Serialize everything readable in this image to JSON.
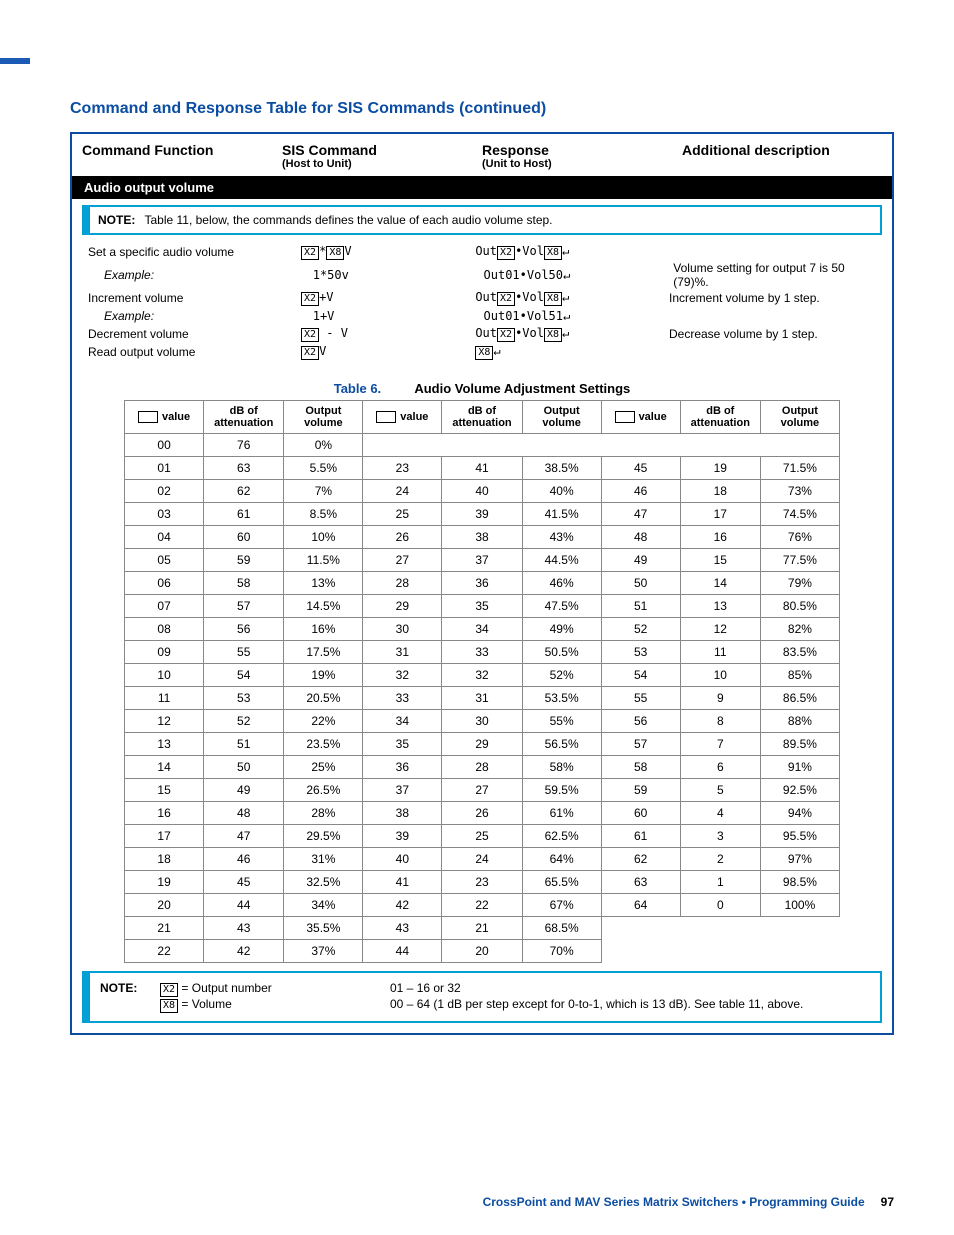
{
  "section_title": "Command and Response Table for SIS Commands (continued)",
  "headers": {
    "h1": "Command Function",
    "h2": "SIS Command",
    "h2s": "(Host to Unit)",
    "h3": "Response",
    "h3s": "(Unit to Host)",
    "h4": "Additional description"
  },
  "blackbar": "Audio output volume",
  "note": "NOTE:",
  "note_text": "Table 11, below, the commands defines the value of each audio volume step.",
  "commands": [
    {
      "name": "Set a specific audio volume",
      "cmd": "[X2]*[X8]V",
      "resp": "Out[X2]•Vol[X8]↵",
      "desc": ""
    },
    {
      "name": "Example:",
      "example": true,
      "cmd": "1*50v",
      "resp": "Out01•Vol50↵",
      "desc": "Volume setting for output 7 is 50 (79)%."
    },
    {
      "name": "Increment volume",
      "cmd": "[X2]+V",
      "resp": "Out[X2]•Vol[X8]↵",
      "desc": "Increment volume by 1 step."
    },
    {
      "name": "Example:",
      "example": true,
      "cmd": "1+V",
      "resp": "Out01•Vol51↵",
      "desc": ""
    },
    {
      "name": "Decrement volume",
      "cmd": "[X2] - V",
      "resp": "Out[X2]•Vol[X8]↵",
      "desc": "Decrease volume by 1 step."
    },
    {
      "name": "Read output volume",
      "cmd": "[X2]V",
      "resp": "[X8]↵",
      "desc": ""
    }
  ],
  "table_caption": {
    "num": "Table 6.",
    "title": "Audio Volume Adjustment Settings"
  },
  "col_labels": {
    "value": "value",
    "db": "dB of\nattenuation",
    "out": "Output\nvolume"
  },
  "chart_data": {
    "type": "table",
    "columns": [
      "value",
      "dB_attenuation",
      "output_volume"
    ],
    "rows": [
      [
        "00",
        76,
        "0%"
      ],
      [
        "01",
        63,
        "5.5%"
      ],
      [
        "02",
        62,
        "7%"
      ],
      [
        "03",
        61,
        "8.5%"
      ],
      [
        "04",
        60,
        "10%"
      ],
      [
        "05",
        59,
        "11.5%"
      ],
      [
        "06",
        58,
        "13%"
      ],
      [
        "07",
        57,
        "14.5%"
      ],
      [
        "08",
        56,
        "16%"
      ],
      [
        "09",
        55,
        "17.5%"
      ],
      [
        "10",
        54,
        "19%"
      ],
      [
        "11",
        53,
        "20.5%"
      ],
      [
        "12",
        52,
        "22%"
      ],
      [
        "13",
        51,
        "23.5%"
      ],
      [
        "14",
        50,
        "25%"
      ],
      [
        "15",
        49,
        "26.5%"
      ],
      [
        "16",
        48,
        "28%"
      ],
      [
        "17",
        47,
        "29.5%"
      ],
      [
        "18",
        46,
        "31%"
      ],
      [
        "19",
        45,
        "32.5%"
      ],
      [
        "20",
        44,
        "34%"
      ],
      [
        "21",
        43,
        "35.5%"
      ],
      [
        "22",
        42,
        "37%"
      ],
      [
        "23",
        41,
        "38.5%"
      ],
      [
        "24",
        40,
        "40%"
      ],
      [
        "25",
        39,
        "41.5%"
      ],
      [
        "26",
        38,
        "43%"
      ],
      [
        "27",
        37,
        "44.5%"
      ],
      [
        "28",
        36,
        "46%"
      ],
      [
        "29",
        35,
        "47.5%"
      ],
      [
        "30",
        34,
        "49%"
      ],
      [
        "31",
        33,
        "50.5%"
      ],
      [
        "32",
        32,
        "52%"
      ],
      [
        "33",
        31,
        "53.5%"
      ],
      [
        "34",
        30,
        "55%"
      ],
      [
        "35",
        29,
        "56.5%"
      ],
      [
        "36",
        28,
        "58%"
      ],
      [
        "37",
        27,
        "59.5%"
      ],
      [
        "38",
        26,
        "61%"
      ],
      [
        "39",
        25,
        "62.5%"
      ],
      [
        "40",
        24,
        "64%"
      ],
      [
        "41",
        23,
        "65.5%"
      ],
      [
        "42",
        22,
        "67%"
      ],
      [
        "43",
        21,
        "68.5%"
      ],
      [
        "44",
        20,
        "70%"
      ],
      [
        "45",
        19,
        "71.5%"
      ],
      [
        "46",
        18,
        "73%"
      ],
      [
        "47",
        17,
        "74.5%"
      ],
      [
        "48",
        16,
        "76%"
      ],
      [
        "49",
        15,
        "77.5%"
      ],
      [
        "50",
        14,
        "79%"
      ],
      [
        "51",
        13,
        "80.5%"
      ],
      [
        "52",
        12,
        "82%"
      ],
      [
        "53",
        11,
        "83.5%"
      ],
      [
        "54",
        10,
        "85%"
      ],
      [
        "55",
        9,
        "86.5%"
      ],
      [
        "56",
        8,
        "88%"
      ],
      [
        "57",
        7,
        "89.5%"
      ],
      [
        "58",
        6,
        "91%"
      ],
      [
        "59",
        5,
        "92.5%"
      ],
      [
        "60",
        4,
        "94%"
      ],
      [
        "61",
        3,
        "95.5%"
      ],
      [
        "62",
        2,
        "97%"
      ],
      [
        "63",
        1,
        "98.5%"
      ],
      [
        "64",
        0,
        "100%"
      ]
    ]
  },
  "footnotes": {
    "label": "NOTE:",
    "x2": "= Output number",
    "x2_r": "01 – 16 or 32",
    "x8": "= Volume",
    "x8_r": "00 – 64 (1 dB per step except for 0-to-1, which is 13 dB). See table 11, above."
  },
  "footer": {
    "title": "CrossPoint and MAV Series Matrix Switchers • Programming Guide",
    "page": "97"
  }
}
